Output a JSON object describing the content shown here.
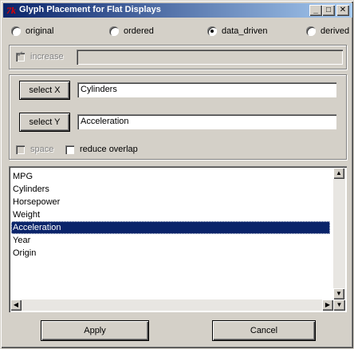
{
  "window": {
    "title": "Glyph Placement for Flat Displays",
    "app_icon_glyph": "7k",
    "minimize_glyph": "_",
    "maximize_glyph": "□",
    "close_glyph": "✕"
  },
  "placement_modes": [
    {
      "label": "original",
      "selected": false
    },
    {
      "label": "ordered",
      "selected": false
    },
    {
      "label": "data_driven",
      "selected": true
    },
    {
      "label": "derived",
      "selected": false
    }
  ],
  "increase": {
    "label": "increase",
    "checked": true,
    "enabled": false,
    "value": ""
  },
  "axes": {
    "x_button": "select X",
    "x_value": "Cylinders",
    "y_button": "select Y",
    "y_value": "Acceleration"
  },
  "options": {
    "space_label": "space",
    "reduce_overlap_label": "reduce overlap"
  },
  "variables": {
    "items": [
      "MPG",
      "Cylinders",
      "Horsepower",
      "Weight",
      "Acceleration",
      "Year",
      "Origin"
    ],
    "selected": "Acceleration"
  },
  "scroll_glyphs": {
    "up": "▲",
    "down": "▼",
    "left": "◀",
    "right": "▶"
  },
  "footer": {
    "apply": "Apply",
    "cancel": "Cancel"
  }
}
